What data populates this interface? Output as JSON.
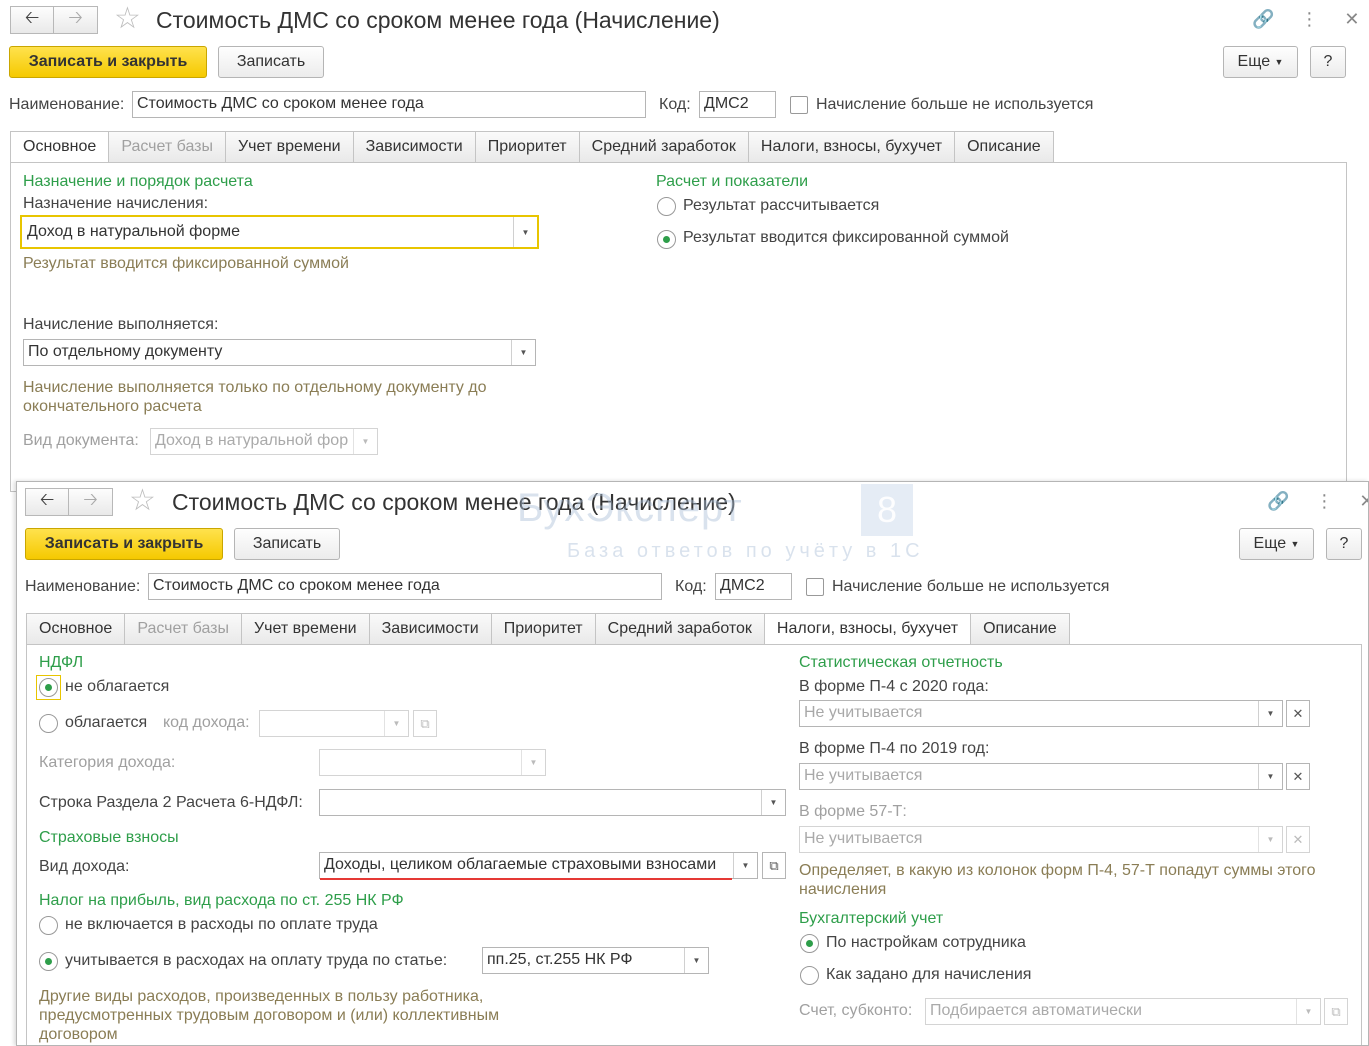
{
  "window1": {
    "title": "Стоимость ДМС со сроком менее года (Начисление)",
    "toolbar": {
      "save_close": "Записать и закрыть",
      "save": "Записать",
      "more": "Еще",
      "help": "?"
    },
    "name_label": "Наименование:",
    "name_value": "Стоимость ДМС со сроком менее года",
    "code_label": "Код:",
    "code_value": "ДМС2",
    "unused_label": "Начисление больше не используется",
    "tabs": [
      "Основное",
      "Расчет базы",
      "Учет времени",
      "Зависимости",
      "Приоритет",
      "Средний заработок",
      "Налоги, взносы, бухучет",
      "Описание"
    ],
    "main": {
      "section_left": "Назначение и порядок расчета",
      "purpose_label": "Назначение начисления:",
      "purpose_value": "Доход в натуральной форме",
      "purpose_hint": "Результат вводится фиксированной суммой",
      "exec_label": "Начисление выполняется:",
      "exec_value": "По отдельному документу",
      "exec_hint": "Начисление выполняется только по отдельному документу до окончательного расчета",
      "doc_label": "Вид документа:",
      "doc_value": "Доход в натуральной фор",
      "section_right": "Расчет и показатели",
      "radio1": "Результат рассчитывается",
      "radio2": "Результат вводится фиксированной суммой"
    }
  },
  "window2": {
    "title": "Стоимость ДМС со сроком менее года (Начисление)",
    "toolbar": {
      "save_close": "Записать и закрыть",
      "save": "Записать",
      "more": "Еще",
      "help": "?"
    },
    "name_label": "Наименование:",
    "name_value": "Стоимость ДМС со сроком менее года",
    "code_label": "Код:",
    "code_value": "ДМС2",
    "unused_label": "Начисление больше не используется",
    "tabs": [
      "Основное",
      "Расчет базы",
      "Учет времени",
      "Зависимости",
      "Приоритет",
      "Средний заработок",
      "Налоги, взносы, бухучет",
      "Описание"
    ],
    "taxes": {
      "ndfl_title": "НДФЛ",
      "ndfl_r1": "не облагается",
      "ndfl_r2": "облагается",
      "income_code_label": "код дохода:",
      "income_cat_label": "Категория дохода:",
      "line6_label": "Строка Раздела 2 Расчета 6-НДФЛ:",
      "ins_title": "Страховые взносы",
      "income_type_label": "Вид дохода:",
      "income_type_value": "Доходы, целиком облагаемые страховыми взносами",
      "profit_title": "Налог на прибыль, вид расхода по ст. 255 НК РФ",
      "profit_r1": "не включается в расходы по оплате труда",
      "profit_r2": "учитывается в расходах на оплату труда по статье:",
      "article_value": "пп.25, ст.255 НК РФ",
      "profit_hint": "Другие виды расходов, произведенных в пользу работника, предусмотренных трудовым договором и (или) коллективным договором",
      "stat_title": "Статистическая отчетность",
      "p4_2020_label": "В форме П-4 с 2020 года:",
      "p4_2020_value": "Не учитывается",
      "p4_2019_label": "В форме П-4 по 2019 год:",
      "p4_2019_value": "Не учитывается",
      "f57_label": "В форме 57-Т:",
      "f57_value": "Не учитывается",
      "stat_hint": "Определяет, в какую из колонок форм П-4, 57-Т попадут суммы этого начисления",
      "acc_title": "Бухгалтерский учет",
      "acc_r1": "По настройкам сотрудника",
      "acc_r2": "Как задано для начисления",
      "acc_label": "Счет, субконто:",
      "acc_value": "Подбирается автоматически"
    }
  },
  "watermark": {
    "brand": "БухЭксперт",
    "badge": "8",
    "tagline": "База ответов по учёту в 1С"
  },
  "colors": {
    "accent_yellow": "#f5c900",
    "section_green": "#2e9e4a",
    "hint": "#8a7d55",
    "highlight_red": "#e53935"
  }
}
